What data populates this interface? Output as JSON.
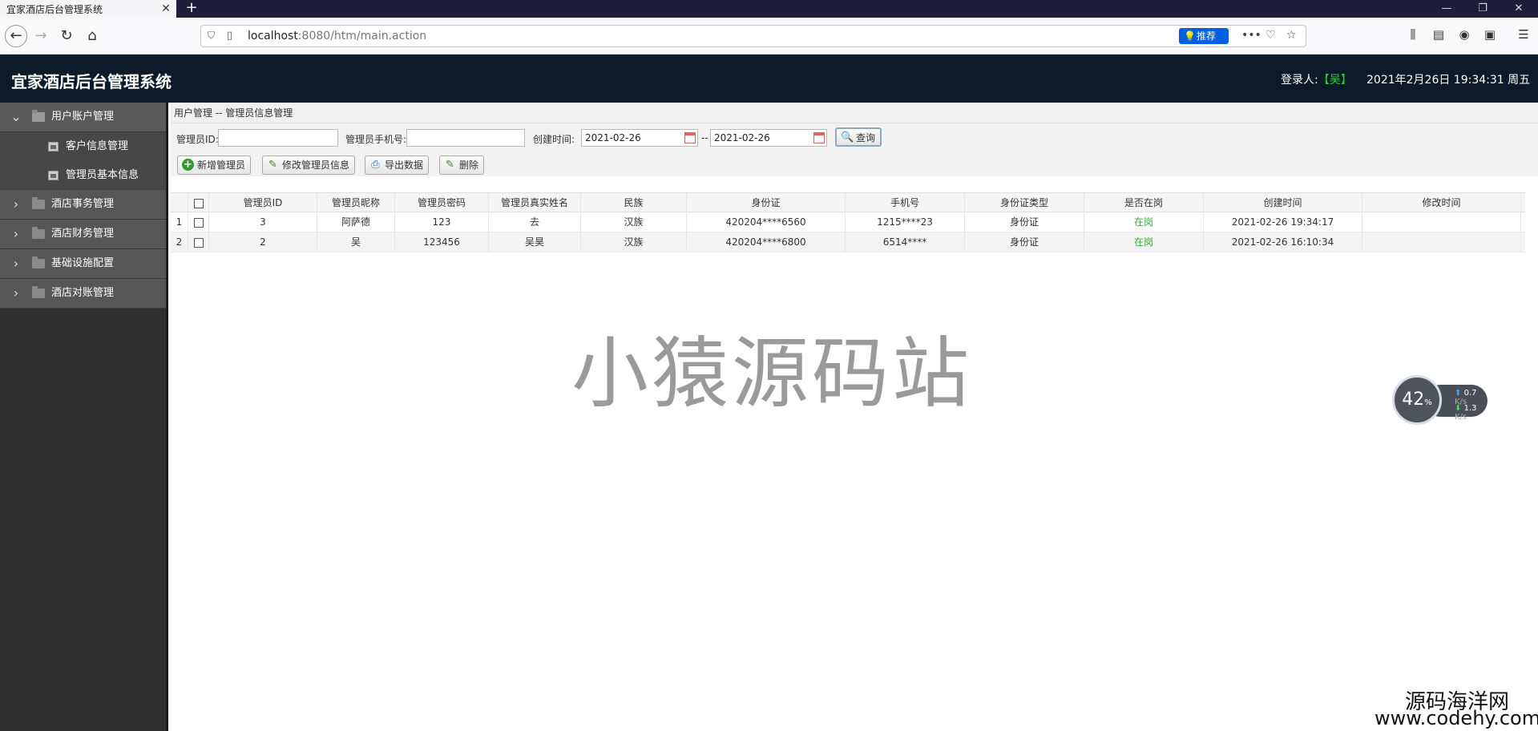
{
  "browser": {
    "tab_title": "宜家酒店后台管理系统",
    "url_host": "localhost",
    "url_rest": ":8080/htm/main.action",
    "recommend_label": "推荐"
  },
  "header": {
    "title": "宜家酒店后台管理系统",
    "login_label": "登录人:",
    "login_user": "【吴】",
    "datetime": "2021年2月26日 19:34:31 周五"
  },
  "sidebar": {
    "items": [
      {
        "label": "用户账户管理",
        "open": true,
        "children": [
          "客户信息管理",
          "管理员基本信息"
        ]
      },
      {
        "label": "酒店事务管理"
      },
      {
        "label": "酒店财务管理"
      },
      {
        "label": "基础设施配置"
      },
      {
        "label": "酒店对账管理"
      }
    ]
  },
  "breadcrumb": "用户管理 -- 管理员信息管理",
  "filter": {
    "admin_id_label": "管理员ID:",
    "admin_id_value": "",
    "phone_label": "管理员手机号:",
    "phone_value": "",
    "created_label": "创建时间:",
    "date_from": "2021-02-26",
    "date_sep": "--",
    "date_to": "2021-02-26",
    "query_label": "查询"
  },
  "toolbar": {
    "add_label": "新增管理员",
    "edit_label": "修改管理员信息",
    "export_label": "导出数据",
    "delete_label": "删除"
  },
  "table": {
    "columns": [
      "管理员ID",
      "管理员昵称",
      "管理员密码",
      "管理员真实姓名",
      "民族",
      "身份证",
      "手机号",
      "身份证类型",
      "是否在岗",
      "创建时间",
      "修改时间"
    ],
    "rows": [
      {
        "no": "1",
        "id": "3",
        "nick": "阿萨德",
        "pwd": "123",
        "name": "去",
        "nation": "汉族",
        "idcard": "420204****6560",
        "phone": "1215****23",
        "idtype": "身份证",
        "duty": "在岗",
        "created": "2021-02-26 19:34:17",
        "modified": ""
      },
      {
        "no": "2",
        "id": "2",
        "nick": "吴",
        "pwd": "123456",
        "name": "吴昊",
        "nation": "汉族",
        "idcard": "420204****6800",
        "phone": "6514****",
        "idtype": "身份证",
        "duty": "在岗",
        "created": "2021-02-26 16:10:34",
        "modified": ""
      }
    ]
  },
  "watermark": {
    "center": "小猿源码站",
    "corner_line1": "源码海洋网",
    "corner_line2": "www.codehy.com"
  },
  "net_widget": {
    "percent": "42",
    "percent_unit": "%",
    "up": "0.7",
    "down": "1.3",
    "unit": "K/s"
  },
  "colors": {
    "header_bg": "#0c1a29",
    "sidebar_bg": "#2f2f2f",
    "accent_blue": "#0060df",
    "duty_green": "#3aa83a"
  }
}
